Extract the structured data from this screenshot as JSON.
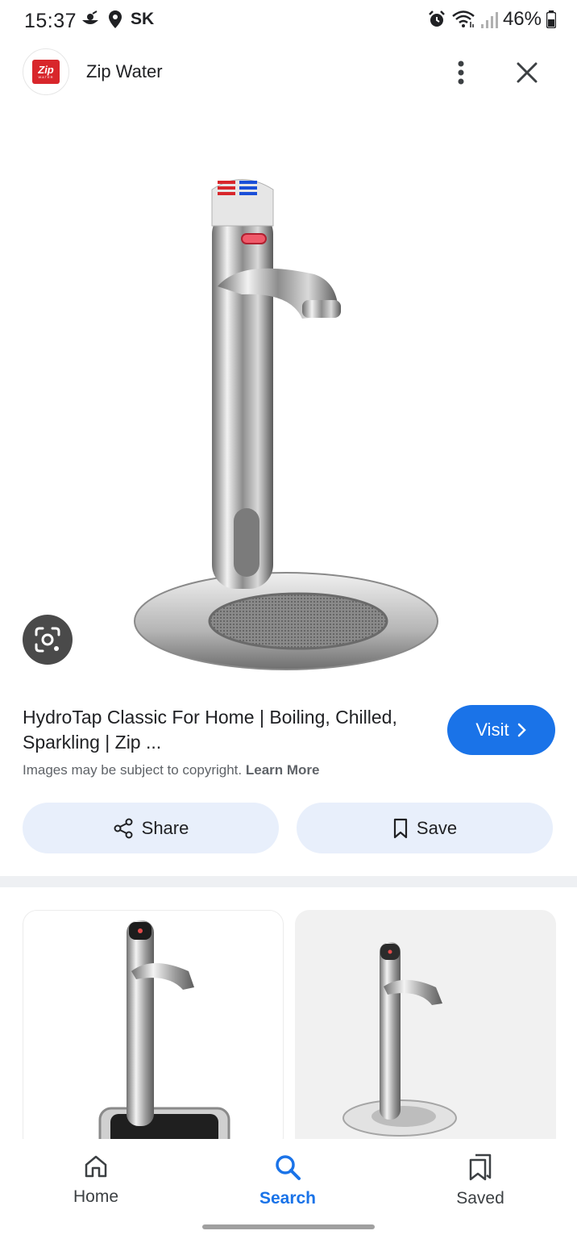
{
  "status_bar": {
    "time": "15:37",
    "carrier": "SK",
    "battery": "46%",
    "icons": [
      "cloud-weather-icon",
      "location-pin-icon",
      "alarm-icon",
      "wifi-icon",
      "signal-icon",
      "battery-icon"
    ]
  },
  "header": {
    "site_name": "Zip Water",
    "logo_text": "Zip",
    "logo_subtext": "WATER",
    "brand_color": "#d8262b"
  },
  "result": {
    "title": "HydroTap Classic For Home | Boiling, Chilled, Sparkling | Zip ...",
    "visit_label": "Visit",
    "copyright_text": "Images may be subject to copyright.",
    "learn_more": "Learn More"
  },
  "actions": {
    "share_label": "Share",
    "save_label": "Save"
  },
  "nav": {
    "items": [
      {
        "label": "Home",
        "icon": "home-icon",
        "active": false
      },
      {
        "label": "Search",
        "icon": "search-icon",
        "active": true
      },
      {
        "label": "Saved",
        "icon": "saved-bookmarks-icon",
        "active": false
      }
    ],
    "accent": "#1a73e8"
  }
}
